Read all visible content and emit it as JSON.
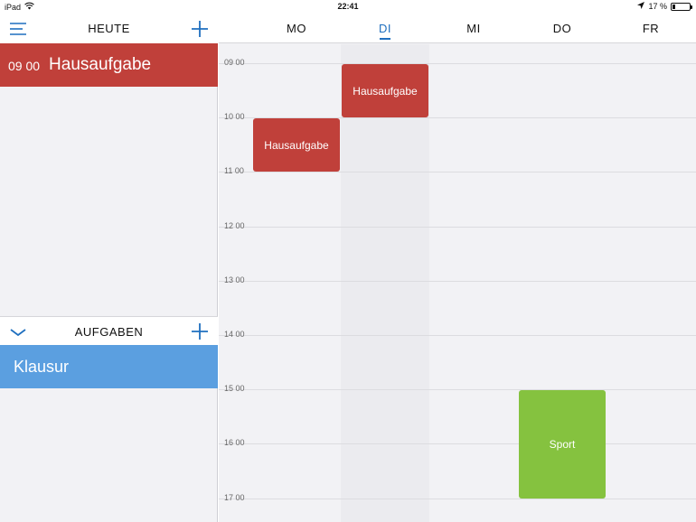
{
  "status_bar": {
    "device": "iPad",
    "time": "22:41",
    "battery_text": "17 %",
    "battery_level": 0.17
  },
  "today_panel": {
    "title": "HEUTE",
    "items": [
      {
        "time": "09 00",
        "label": "Hausaufgabe",
        "color": "#c0403a"
      }
    ]
  },
  "tasks_panel": {
    "title": "AUFGABEN",
    "items": [
      {
        "label": "Klausur",
        "color": "#5b9fe0"
      }
    ]
  },
  "calendar": {
    "days": [
      "MO",
      "DI",
      "MI",
      "DO",
      "FR"
    ],
    "selected_day": "DI",
    "hours": [
      "09 00",
      "10 00",
      "11 00",
      "12 00",
      "13 00",
      "14 00",
      "15 00",
      "16 00",
      "17 00"
    ],
    "events": [
      {
        "day": "MO",
        "start": "10:00",
        "end": "11:00",
        "label": "Hausaufgabe",
        "color": "#c0403a"
      },
      {
        "day": "DI",
        "start": "09:00",
        "end": "10:00",
        "label": "Hausaufgabe",
        "color": "#c0403a"
      },
      {
        "day": "DO",
        "start": "15:00",
        "end": "17:00",
        "label": "Sport",
        "color": "#85c23f"
      }
    ]
  },
  "colors": {
    "accent": "#1f6fbf",
    "event_red": "#c0403a",
    "event_green": "#85c23f",
    "task_blue": "#5b9fe0"
  }
}
